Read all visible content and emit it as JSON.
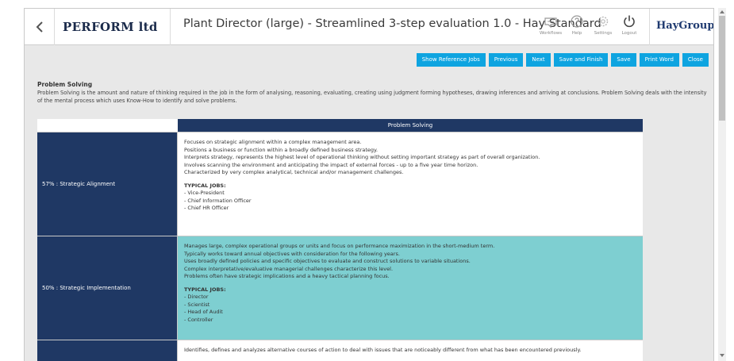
{
  "header": {
    "company": "PERFORM ltd",
    "title": "Plant Director (large) - Streamlined 3-step evaluation 1.0 - Hay Standard",
    "icons": [
      {
        "icon": "workflows-icon",
        "label": "Workflows"
      },
      {
        "icon": "help-icon",
        "label": "Help"
      },
      {
        "icon": "settings-icon",
        "label": "Settings"
      },
      {
        "icon": "logout-icon",
        "label": "Logout"
      }
    ],
    "logo": "HayGroup®"
  },
  "toolbar": {
    "show_reference": "Show Reference Jobs",
    "previous": "Previous",
    "next": "Next",
    "save_finish": "Save and Finish",
    "save": "Save",
    "print": "Print Word",
    "close": "Close"
  },
  "section": {
    "title": "Problem Solving",
    "description": "Problem Solving is the amount and nature of thinking required in the job in the form of analysing, reasoning, evaluating, creating using judgment forming hypotheses, drawing inferences and arriving at conclusions. Problem Solving deals with the intensity of the mental process which uses Know-How to identify and solve problems."
  },
  "table": {
    "header": "Problem Solving",
    "rows": [
      {
        "level": "57% : Strategic Alignment",
        "lines": [
          "Focuses on strategic alignment within a complex management area.",
          "Positions a business or function within a broadly defined business strategy.",
          "Interprets strategy, represents the highest level of operational thinking without setting important strategy as part of overall organization.",
          "Involves scanning the environment and anticipating the impact of external forces - up to a five year time horizon.",
          "Characterized by very complex analytical, technical and/or management challenges."
        ],
        "typical_title": "TYPICAL JOBS:",
        "jobs": [
          "- Vice-President",
          "- Chief Information Officer",
          "- Chief HR Officer"
        ]
      },
      {
        "level": "50% : Strategic Implementation",
        "lines": [
          "Manages large, complex operational groups or units and focus on performance maximization in the short-medium term.",
          "Typically works toward annual objectives with consideration for the following years.",
          "Uses broadly defined policies and specific objectives to evaluate and construct solutions to variable situations.",
          "Complex interpretative/evaluative managerial challenges characterize this level.",
          "Problems often have strategic implications and a heavy tactical planning focus."
        ],
        "typical_title": "TYPICAL JOBS:",
        "jobs": [
          "- Director",
          "- Scientist",
          "- Head of Audit",
          "- Controller"
        ]
      },
      {
        "level": "",
        "lines": [
          "Identifies, defines and analyzes alternative courses of action to deal with issues that are noticeably different from what has been encountered previously."
        ]
      }
    ]
  },
  "colors": {
    "navy": "#1f3864",
    "teal": "#7ecfd1",
    "button": "#0ea4e0"
  }
}
